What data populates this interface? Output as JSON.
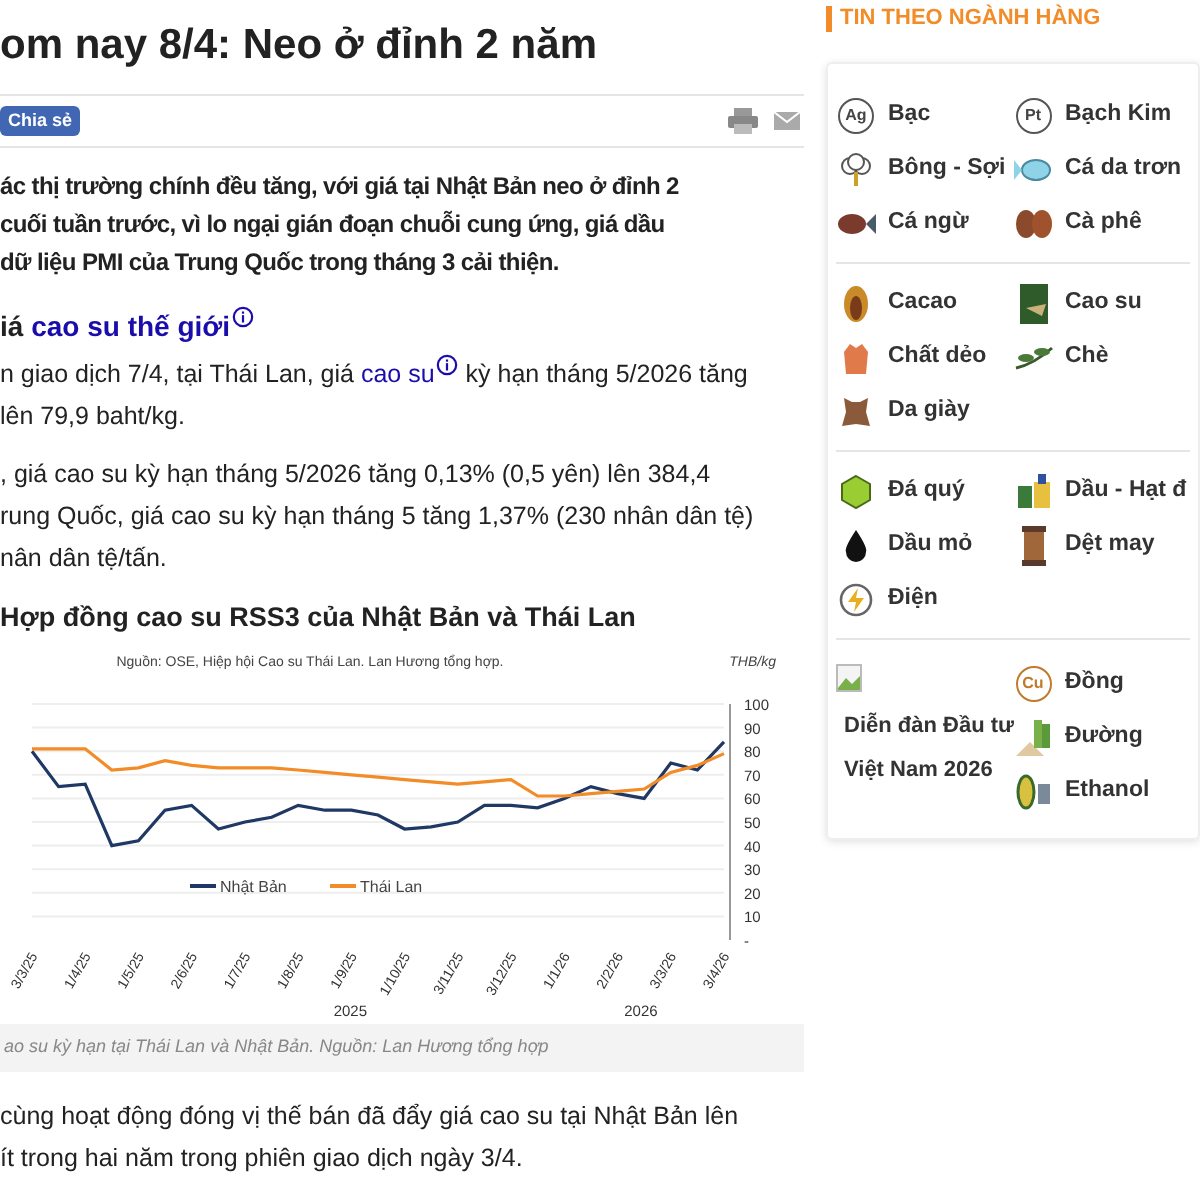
{
  "article": {
    "title": "om nay 8/4: Neo ở đỉnh 2 năm",
    "share_button": "Chia sẻ",
    "lead_lines": [
      "ác thị trường chính đều tăng, với giá tại Nhật Bản neo ở đỉnh 2",
      "cuối tuần trước, vì lo ngại gián đoạn chuỗi cung ứng, giá dầu",
      "dữ liệu PMI của Trung Quốc trong tháng 3 cải thiện."
    ],
    "heading": {
      "text": "iá ",
      "link": "cao su thế giới",
      "info": true
    },
    "paragraph_1": {
      "lines": [
        {
          "segments": [
            {
              "kind": "text",
              "text": "n giao dịch 7/4, tại Thái Lan, giá "
            },
            {
              "kind": "link",
              "text": "cao su",
              "info": true
            },
            {
              "kind": "text",
              "text": " kỳ hạn tháng 5/2026 tăng"
            }
          ]
        },
        {
          "segments": [
            {
              "kind": "text",
              "text": "lên 79,9 baht/kg."
            }
          ]
        }
      ]
    },
    "paragraph_2": {
      "lines": [
        ", giá cao su kỳ hạn tháng 5/2026 tăng 0,13% (0,5 yên) lên 384,4",
        "rung Quốc, giá cao su kỳ hạn tháng 5 tăng 1,37% (230 nhân dân tệ)",
        "nân dân tệ/tấn."
      ]
    },
    "chart_heading": "Hợp đồng cao su RSS3 của Nhật Bản và Thái Lan",
    "chart": {
      "source": "Nguồn: OSE, Hiệp hội Cao su Thái Lan. Lan Hương tổng hợp.",
      "years": [
        "2025",
        "2026"
      ],
      "chart_data": {
        "type": "line",
        "ylabel": "THB/kg",
        "ylim": [
          0,
          100
        ],
        "grid": true,
        "legend": true,
        "yticks": [
          {
            "value": 0,
            "label": "-"
          },
          10,
          20,
          30,
          40,
          50,
          60,
          70,
          80,
          90,
          100
        ],
        "categories": [
          "3/3/25",
          null,
          "1/4/25",
          null,
          "1/5/25",
          null,
          "2/6/25",
          null,
          "1/7/25",
          null,
          "1/8/25",
          null,
          "1/9/25",
          null,
          "1/10/25",
          null,
          "3/11/25",
          null,
          "3/12/25",
          null,
          "1/1/26",
          null,
          "2/2/26",
          null,
          "3/3/26",
          null,
          "3/4/26"
        ],
        "series": [
          {
            "name": "Nhật Bản",
            "color": "#1f3864",
            "values": [
              80,
              65,
              66,
              40,
              42,
              55,
              57,
              47,
              50,
              52,
              57,
              55,
              55,
              53,
              47,
              48,
              50,
              57,
              57,
              56,
              60,
              65,
              62,
              60,
              75,
              72,
              84
            ]
          },
          {
            "name": "Thái Lan",
            "color": "#f28c28",
            "values": [
              81,
              81,
              81,
              72,
              73,
              76,
              74,
              73,
              73,
              73,
              72,
              71,
              70,
              69,
              68,
              67,
              66,
              67,
              68,
              61,
              61,
              62,
              63,
              64,
              71,
              74,
              79
            ]
          }
        ]
      }
    },
    "caption": "ao su kỳ hạn tại Thái Lan và Nhật Bản. Nguồn: Lan Hương tổng hợp",
    "paragraph_3": {
      "lines": [
        "cùng hoạt động đóng vị thế bán đã đẩy giá cao su tại Nhật Bản lên",
        "ít trong hai năm trong phiên giao dịch ngày 3/4."
      ]
    }
  },
  "sidebar": {
    "title": "TIN THEO NGÀNH HÀNG",
    "groups": [
      {
        "items": [
          {
            "label": "Bạc",
            "icon_text": "Ag"
          },
          {
            "label": "Bạch Kim",
            "icon_text": "Pt"
          },
          {
            "label": "Bông - Sợi"
          },
          {
            "label": "Cá da trơn"
          },
          {
            "label": "Cá ngừ"
          },
          {
            "label": "Cà phê"
          }
        ]
      },
      {
        "items": [
          {
            "label": "Cacao"
          },
          {
            "label": "Cao su"
          },
          {
            "label": "Chất dẻo"
          },
          {
            "label": "Chè"
          },
          {
            "label": "Da giày"
          }
        ]
      },
      {
        "items": [
          {
            "label": "Đá quý"
          },
          {
            "label": "Dầu - Hạt đ"
          },
          {
            "label": "Dầu mỏ"
          },
          {
            "label": "Dệt may"
          },
          {
            "label": "Điện"
          }
        ]
      }
    ],
    "promo": {
      "label": "Diễn đàn Đầu tư Việt Nam 2026"
    },
    "last_items": [
      {
        "label": "Đồng",
        "icon_text": "Cu"
      },
      {
        "label": "Đường"
      },
      {
        "label": "Ethanol"
      }
    ]
  }
}
